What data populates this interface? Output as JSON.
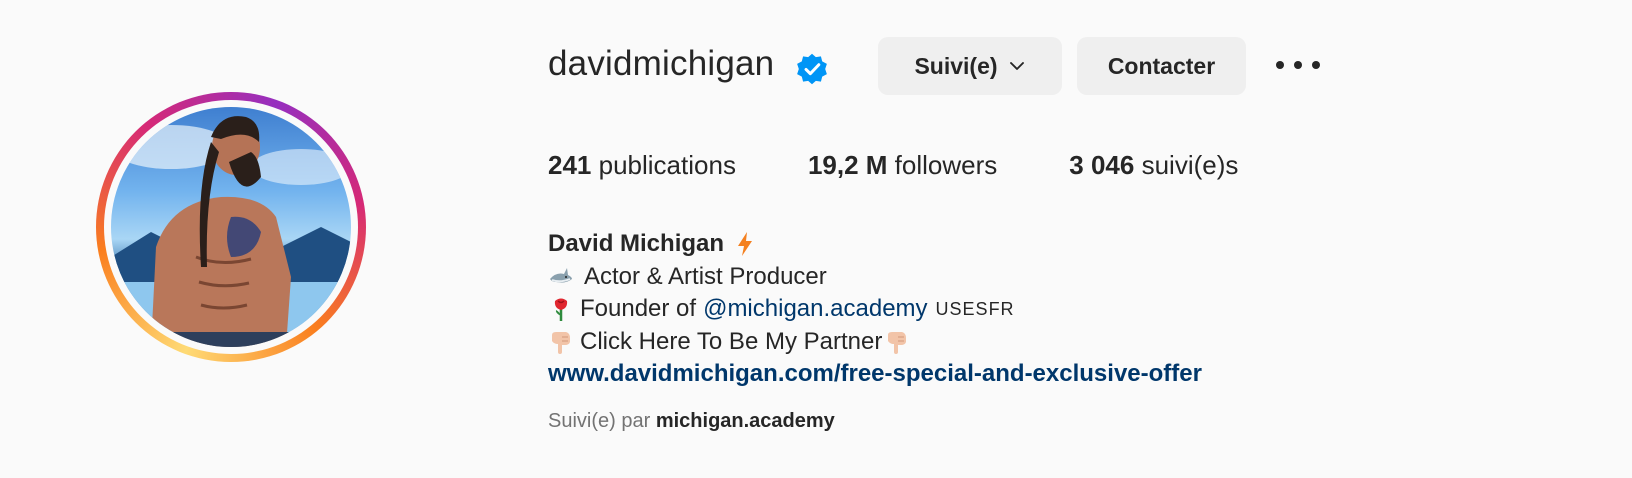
{
  "profile": {
    "username": "davidmichigan",
    "verified": true,
    "follow_button_label": "Suivi(e)",
    "contact_button_label": "Contacter",
    "more_icon": "more-horizontal-icon"
  },
  "stats": {
    "posts_count": "241",
    "posts_label": "publications",
    "followers_count": "19,2 M",
    "followers_label": "followers",
    "following_count": "3 046",
    "following_label": "suivi(e)s"
  },
  "bio": {
    "full_name": "David Michigan",
    "line1_text": "Actor & Artist Producer",
    "line2_prefix": "Founder of",
    "line2_mention": "@michigan.academy",
    "line2_suffix": "USESFR",
    "line3_text": "Click Here To Be My Partner",
    "website": "www.davidmichigan.com/free-special-and-exclusive-offer"
  },
  "followed_by": {
    "prefix": "Suivi(e) par",
    "account": "michigan.academy"
  },
  "colors": {
    "link": "#00376b",
    "verified": "#0095f6",
    "button_bg": "#efefef",
    "bolt": "#f4801f"
  }
}
